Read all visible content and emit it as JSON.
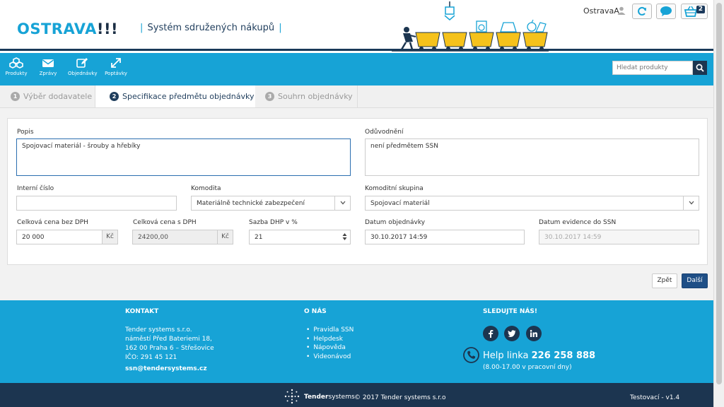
{
  "header": {
    "logo_text": "OSTRAVA",
    "logo_bang": "!!!",
    "tagline": "Systém sdružených nákupů",
    "user_name": "OstravaA",
    "cart_count": "2"
  },
  "nav": {
    "items": [
      {
        "label": "Produkty",
        "icon": "cubes-icon"
      },
      {
        "label": "Zprávy",
        "icon": "envelope-icon"
      },
      {
        "label": "Objednávky",
        "icon": "edit-icon"
      },
      {
        "label": "Poptávky",
        "icon": "expand-icon"
      }
    ],
    "search_placeholder": "Hledat produkty"
  },
  "steps": [
    {
      "num": "1",
      "label": "Výběr dodavatele"
    },
    {
      "num": "2",
      "label": "Specifikace předmětu objednávky"
    },
    {
      "num": "3",
      "label": "Souhrn objednávky"
    }
  ],
  "form": {
    "popis": {
      "label": "Popis",
      "value": "Spojovací materiál - šrouby a hřebíky"
    },
    "oduvodneni": {
      "label": "Odůvodnění",
      "value": "není předmětem SSN"
    },
    "interni_cislo": {
      "label": "Interní číslo",
      "value": ""
    },
    "komodita": {
      "label": "Komodita",
      "value": "Materiálně technické zabezpečení"
    },
    "komoditni_skupina": {
      "label": "Komoditní skupina",
      "value": "Spojovací materiál"
    },
    "cena_bez_dph": {
      "label": "Celková cena bez DPH",
      "value": "20 000",
      "unit": "Kč"
    },
    "cena_s_dph": {
      "label": "Celková cena s DPH",
      "value": "24200,00",
      "unit": "Kč"
    },
    "sazba_dph": {
      "label": "Sazba DHP v %",
      "value": "21"
    },
    "datum_objednavky": {
      "label": "Datum objednávky",
      "value": "30.10.2017 14:59"
    },
    "datum_evidence": {
      "label": "Datum evidence do SSN",
      "value": "30.10.2017 14:59"
    },
    "back_label": "Zpět",
    "next_label": "Další"
  },
  "footer": {
    "contact": {
      "heading": "KONTAKT",
      "company": "Tender systems s.r.o.",
      "street": "náměstí Před Bateriemi 18,",
      "city": "162 00 Praha 6 – Střešovice",
      "ico": "IČO: 291 45 121",
      "email": "ssn@tendersystems.cz"
    },
    "about": {
      "heading": "O NÁS",
      "links": [
        "Pravidla SSN",
        "Helpdesk",
        "Nápověda",
        "Videonávod"
      ]
    },
    "follow": {
      "heading": "SLEDUJTE NÁS!",
      "help_prefix": "Help linka",
      "help_number": "226 258 888",
      "help_hours": "(8.00-17.00 v pracovní dny)"
    }
  },
  "bottom": {
    "brand_bold": "Tender",
    "brand_rest": "systems",
    "copyright": "© 2017 Tender systems s.r.o",
    "version": "Testovací - v1.4"
  },
  "colors": {
    "primary_blue": "#17a3d6",
    "dark_navy": "#1c3550",
    "next_button": "#1f4f86"
  }
}
